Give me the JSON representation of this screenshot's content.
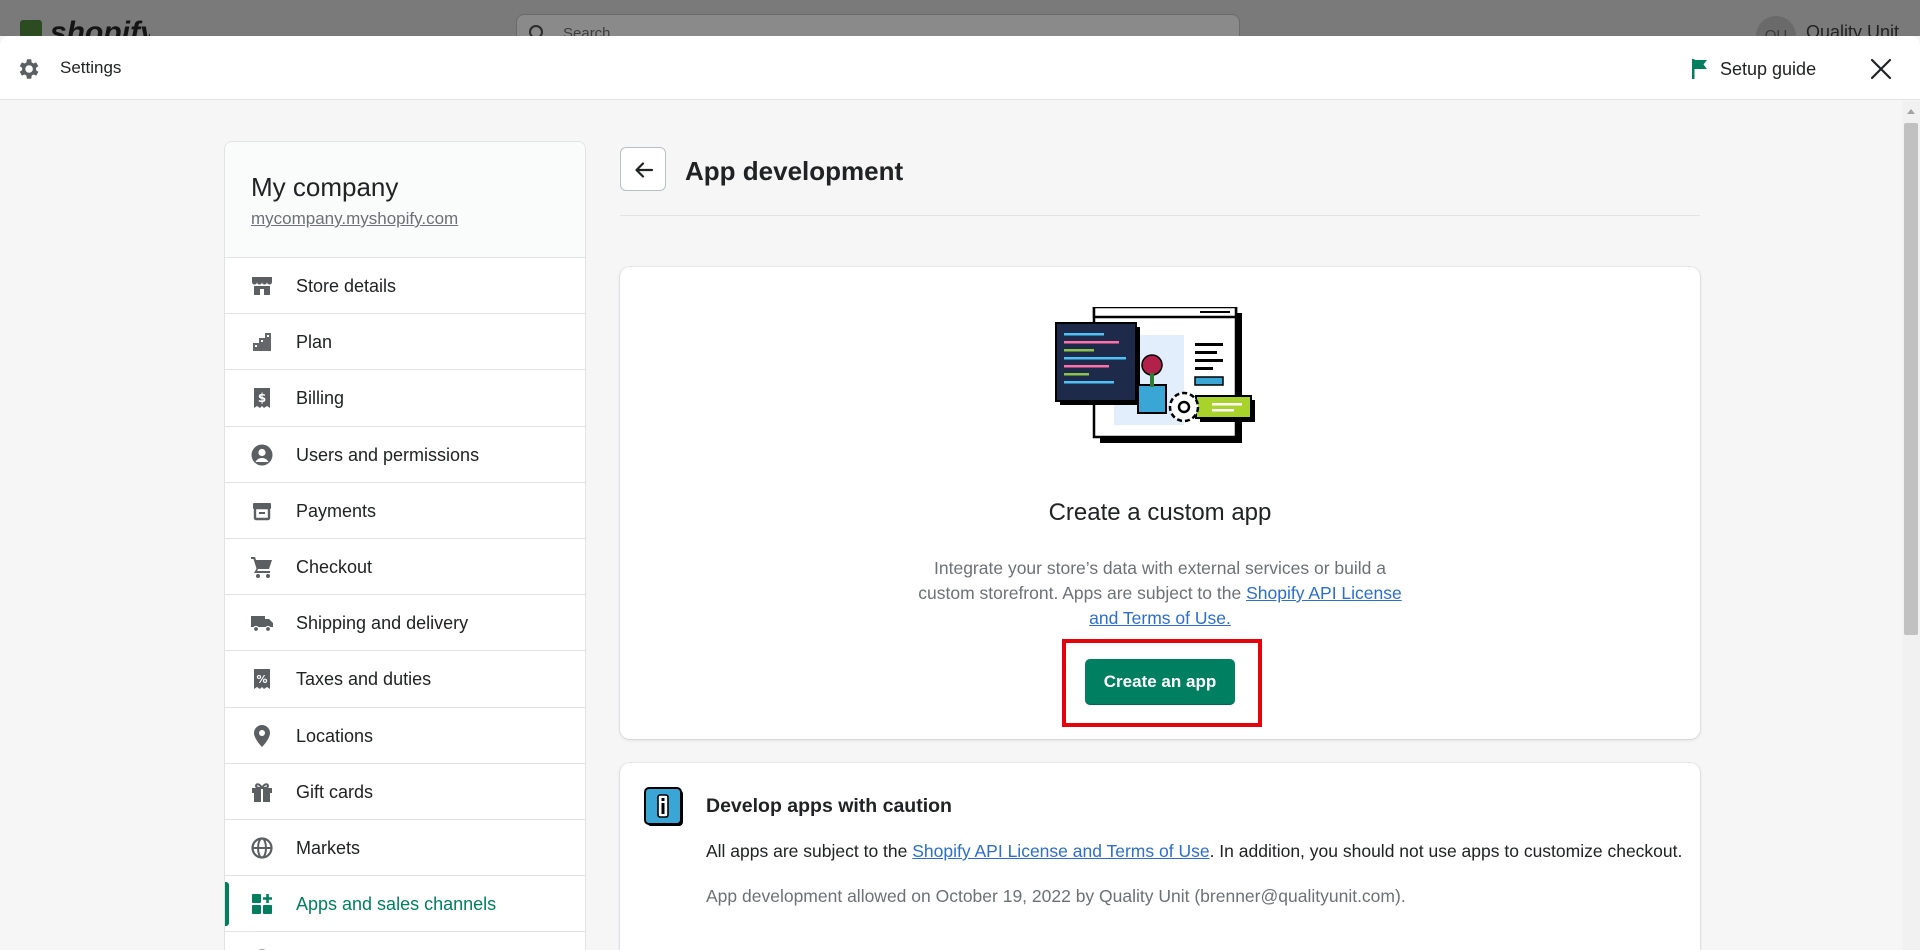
{
  "background": {
    "logo_text": "shopify",
    "search_placeholder": "Search",
    "avatar_initials": "QU",
    "account_name": "Quality Unit"
  },
  "header": {
    "title": "Settings",
    "setup_guide_label": "Setup guide",
    "accent_color": "#008060"
  },
  "sidebar": {
    "store_name": "My company",
    "store_url": "mycompany.myshopify.com",
    "items": [
      {
        "label": "Store details",
        "icon": "store-icon"
      },
      {
        "label": "Plan",
        "icon": "plan-icon"
      },
      {
        "label": "Billing",
        "icon": "billing-icon"
      },
      {
        "label": "Users and permissions",
        "icon": "user-icon"
      },
      {
        "label": "Payments",
        "icon": "payments-icon"
      },
      {
        "label": "Checkout",
        "icon": "cart-icon"
      },
      {
        "label": "Shipping and delivery",
        "icon": "truck-icon"
      },
      {
        "label": "Taxes and duties",
        "icon": "tax-icon"
      },
      {
        "label": "Locations",
        "icon": "location-pin-icon"
      },
      {
        "label": "Gift cards",
        "icon": "gift-icon"
      },
      {
        "label": "Markets",
        "icon": "globe-icon"
      },
      {
        "label": "Apps and sales channels",
        "icon": "apps-icon",
        "active": true
      }
    ]
  },
  "main": {
    "page_title": "App development",
    "custom_app_card": {
      "heading": "Create a custom app",
      "desc_prefix": "Integrate your store’s data with external services or build a custom storefront. Apps are subject to the ",
      "desc_link": "Shopify API License and Terms of Use.",
      "button_label": "Create an app"
    },
    "caution_card": {
      "title": "Develop apps with caution",
      "text_prefix": "All apps are subject to the ",
      "text_link": "Shopify API License and Terms of Use",
      "text_suffix": ". In addition, you should not use apps to customize checkout.",
      "meta": "App development allowed on October 19, 2022 by Quality Unit (brenner@qualityunit.com)."
    }
  }
}
